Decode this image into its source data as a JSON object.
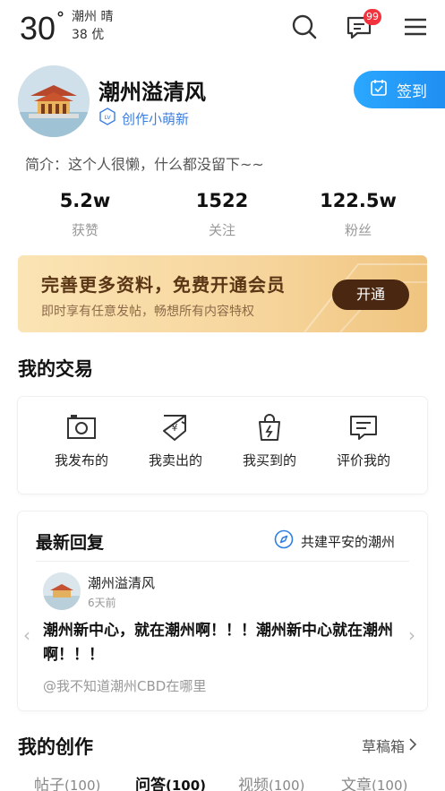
{
  "status": {
    "temperature": "30",
    "temp_unit": "°",
    "city_weather": "潮州 晴",
    "aqi": "38 优",
    "message_badge": "99"
  },
  "profile": {
    "username": "潮州溢清风",
    "level_title": "创作小萌新",
    "level_badge": "LV",
    "checkin_label": "签到",
    "intro": "简介：这个人很懒，什么都没留下~~"
  },
  "stats": [
    {
      "value": "5.2w",
      "label": "获赞"
    },
    {
      "value": "1522",
      "label": "关注"
    },
    {
      "value": "122.5w",
      "label": "粉丝"
    }
  ],
  "vip_banner": {
    "title": "完善更多资料，免费开通会员",
    "subtitle": "即时享有任意发帖，畅想所有内容特权",
    "button": "开通"
  },
  "trades": {
    "title": "我的交易",
    "items": [
      {
        "label": "我发布的",
        "icon": "camera-icon"
      },
      {
        "label": "我卖出的",
        "icon": "yen-tag-icon"
      },
      {
        "label": "我买到的",
        "icon": "shopping-bag-icon"
      },
      {
        "label": "评价我的",
        "icon": "comment-icon"
      }
    ]
  },
  "latest_reply": {
    "title": "最新回复",
    "link_label": "共建平安的潮州",
    "user": "潮州溢清风",
    "time": "6天前",
    "content": "潮州新中心，就在潮州啊！！！潮州新中心就在潮州啊！！！",
    "reference": "@我不知道潮州CBD在哪里"
  },
  "creations": {
    "title": "我的创作",
    "draft_label": "草稿箱",
    "tabs": [
      {
        "label": "帖子",
        "count": "(100)"
      },
      {
        "label": "问答",
        "count": "(100)"
      },
      {
        "label": "视频",
        "count": "(100)"
      },
      {
        "label": "文章",
        "count": "(100)"
      }
    ]
  },
  "colors": {
    "accent_blue": "#1f8df0",
    "badge_red": "#f2323d",
    "vip_button": "#4a2710"
  }
}
